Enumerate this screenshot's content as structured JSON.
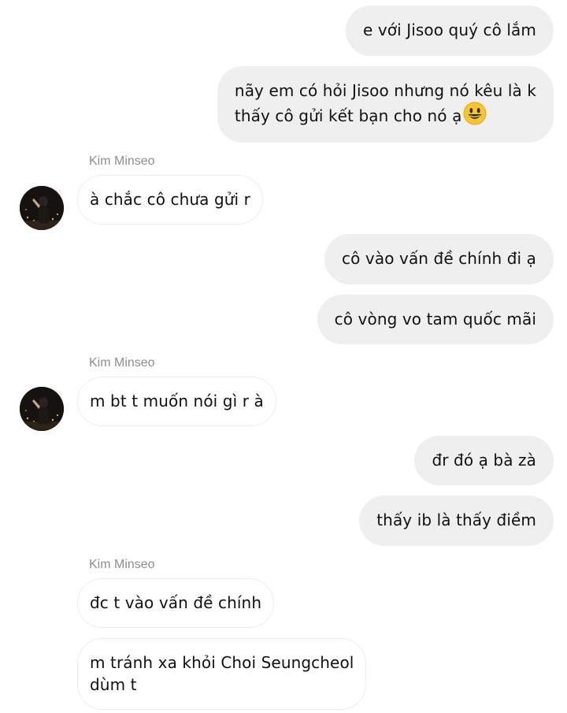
{
  "messages": {
    "m1": "e với Jisoo quý cô lắm",
    "m2_line1": "nãy em có hỏi Jisoo nhưng nó kêu là k",
    "m2_line2": "thấy cô gửi kết bạn cho nó ạ",
    "m2_emoji": "smiling-face-emoji",
    "sender1": "Kim Minseo",
    "m3": "à chắc cô chưa gửi r",
    "m4": "cô vào vấn đề chính đi ạ",
    "m5": "cô vòng vo tam quốc mãi",
    "sender2": "Kim Minseo",
    "m6": "m bt t muốn nói gì r à",
    "m7": "đr đó ạ bà zà",
    "m8": "thấy ib là thấy điềm",
    "sender3": "Kim Minseo",
    "m9": "đc t vào vấn đề chính",
    "m10_line1": "m tránh xa khỏi Choi Seungcheol",
    "m10_line2": "dùm t"
  },
  "colors": {
    "outgoing_bubble": "#efefef",
    "incoming_border": "#ececec",
    "sender_name": "#8e8e8e",
    "text": "#111111",
    "emoji": "#f7c531"
  }
}
